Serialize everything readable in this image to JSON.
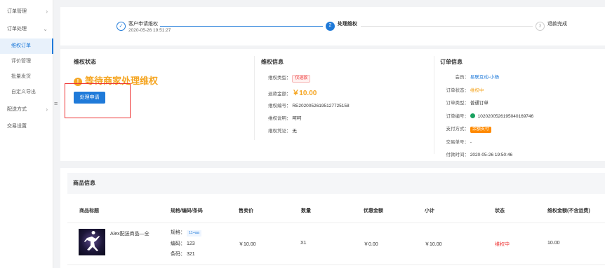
{
  "sidebar": {
    "items": [
      {
        "label": "订单管理",
        "arrow": "›"
      },
      {
        "label": "订单处理",
        "arrow": "⌄"
      },
      {
        "label": "维权订单"
      },
      {
        "label": "评价管理"
      },
      {
        "label": "批量发货"
      },
      {
        "label": "自定义导出"
      },
      {
        "label": "配送方式",
        "arrow": "›"
      },
      {
        "label": "交易设置"
      }
    ],
    "collapse_icon": "≡"
  },
  "steps": [
    {
      "label": "客户申请维权",
      "time": "2020-05-26 19:51:27",
      "mark": "✓"
    },
    {
      "label": "处理维权",
      "mark": "2"
    },
    {
      "label": "退款完成",
      "mark": "3"
    }
  ],
  "status": {
    "title": "维权状态",
    "waiting": "等待商家处理维权",
    "wait_icon": "!",
    "button": "处理申请"
  },
  "refund_info": {
    "title": "维权信息",
    "type_label": "维权类型：",
    "type_value": "仅退款",
    "amount_label": "退款金额：",
    "amount_value": "￥10.00",
    "no_label": "维权编号：",
    "no_value": "RE20200526195127725158",
    "reason_label": "维权说明：",
    "reason_value": "呵呵",
    "proof_label": "维权凭证：",
    "proof_value": "无"
  },
  "order_info": {
    "title": "订单信息",
    "member_label": "会员：",
    "member_value": "易联互动-小杨",
    "status_label": "订单状态：",
    "status_value": "维权中",
    "type_label": "订单类型：",
    "type_value": "普通订单",
    "no_label": "订单编号：",
    "no_value": "1020200526195040169746",
    "pay_label": "支付方式：",
    "pay_value": "余额支付",
    "trade_label": "交易单号：",
    "trade_value": "-",
    "time_label": "付款时间：",
    "time_value": "2020-05-26 19:50:46"
  },
  "goods": {
    "title": "商品信息",
    "columns": [
      "商品标题",
      "规格/编码/条码",
      "售卖价",
      "数量",
      "优惠金额",
      "小计",
      "状态",
      "维权金额(不含运费)"
    ],
    "row": {
      "name": "Alex配送商品—全",
      "spec_label": "规格：",
      "spec_value": "11+aa",
      "code_label": "编码：",
      "code_value": "123",
      "barcode_label": "条码：",
      "barcode_value": "321",
      "price": "￥10.00",
      "qty": "X1",
      "discount": "￥0.00",
      "subtotal": "￥10.00",
      "status": "维权中",
      "refund": "10.00"
    }
  },
  "colors": {
    "accent": "#1f7ad9",
    "warning": "#f5a623",
    "danger": "#e33333"
  }
}
